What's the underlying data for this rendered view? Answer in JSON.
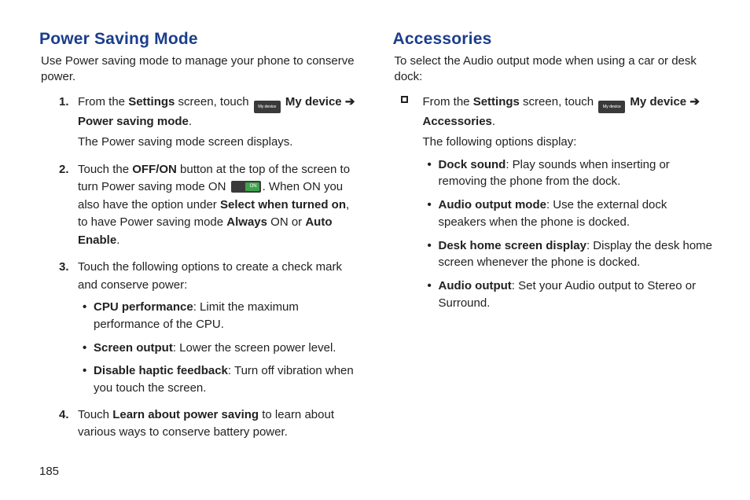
{
  "page_number": "185",
  "left": {
    "heading": "Power Saving Mode",
    "lead": "Use Power saving mode to manage your phone to conserve power.",
    "steps": {
      "s1": {
        "num": "1.",
        "pre": "From the ",
        "settings": "Settings",
        "mid1": " screen, touch ",
        "mydevice": " My device ",
        "arrow": "➔",
        "psm": " Power saving mode",
        "period": ".",
        "after": "The Power saving mode screen displays."
      },
      "s2": {
        "num": "2.",
        "t1": "Touch the ",
        "offon": "OFF/ON",
        "t2": " button at the top of the screen to turn Power saving mode ON ",
        "t3": ". When ON you also have the option under ",
        "sel": "Select when turned on",
        "t4": ", to have Power saving mode ",
        "always": "Always",
        "t5": " ON or ",
        "auto": "Auto Enable",
        "t6": "."
      },
      "s3": {
        "num": "3.",
        "intro": "Touch the following options to create a check mark and conserve power:",
        "b1_label": "CPU performance",
        "b1_text": ": Limit the maximum performance of the CPU.",
        "b2_label": "Screen output",
        "b2_text": ": Lower the screen power level.",
        "b3_label": "Disable haptic feedback",
        "b3_text": ": Turn off vibration when you touch the screen."
      },
      "s4": {
        "num": "4.",
        "t1": "Touch ",
        "learn": "Learn about power saving",
        "t2": " to learn about various ways to conserve battery power."
      }
    }
  },
  "right": {
    "heading": "Accessories",
    "lead": "To select the Audio output mode when using a car or desk dock:",
    "step": {
      "pre": "From the ",
      "settings": "Settings",
      "mid1": " screen, touch ",
      "mydevice": " My device ",
      "arrow": "➔",
      "acc": " Accessories",
      "period": ".",
      "after": "The following options display:",
      "b1_label": "Dock sound",
      "b1_text": ": Play sounds when inserting or removing the phone from the dock.",
      "b2_label": "Audio output mode",
      "b2_text": ": Use the external dock speakers when the phone is docked.",
      "b3_label": "Desk home screen display",
      "b3_text": ": Display the desk home screen whenever the phone is docked.",
      "b4_label": "Audio output",
      "b4_text": ": Set your Audio output to Stereo or Surround."
    }
  }
}
